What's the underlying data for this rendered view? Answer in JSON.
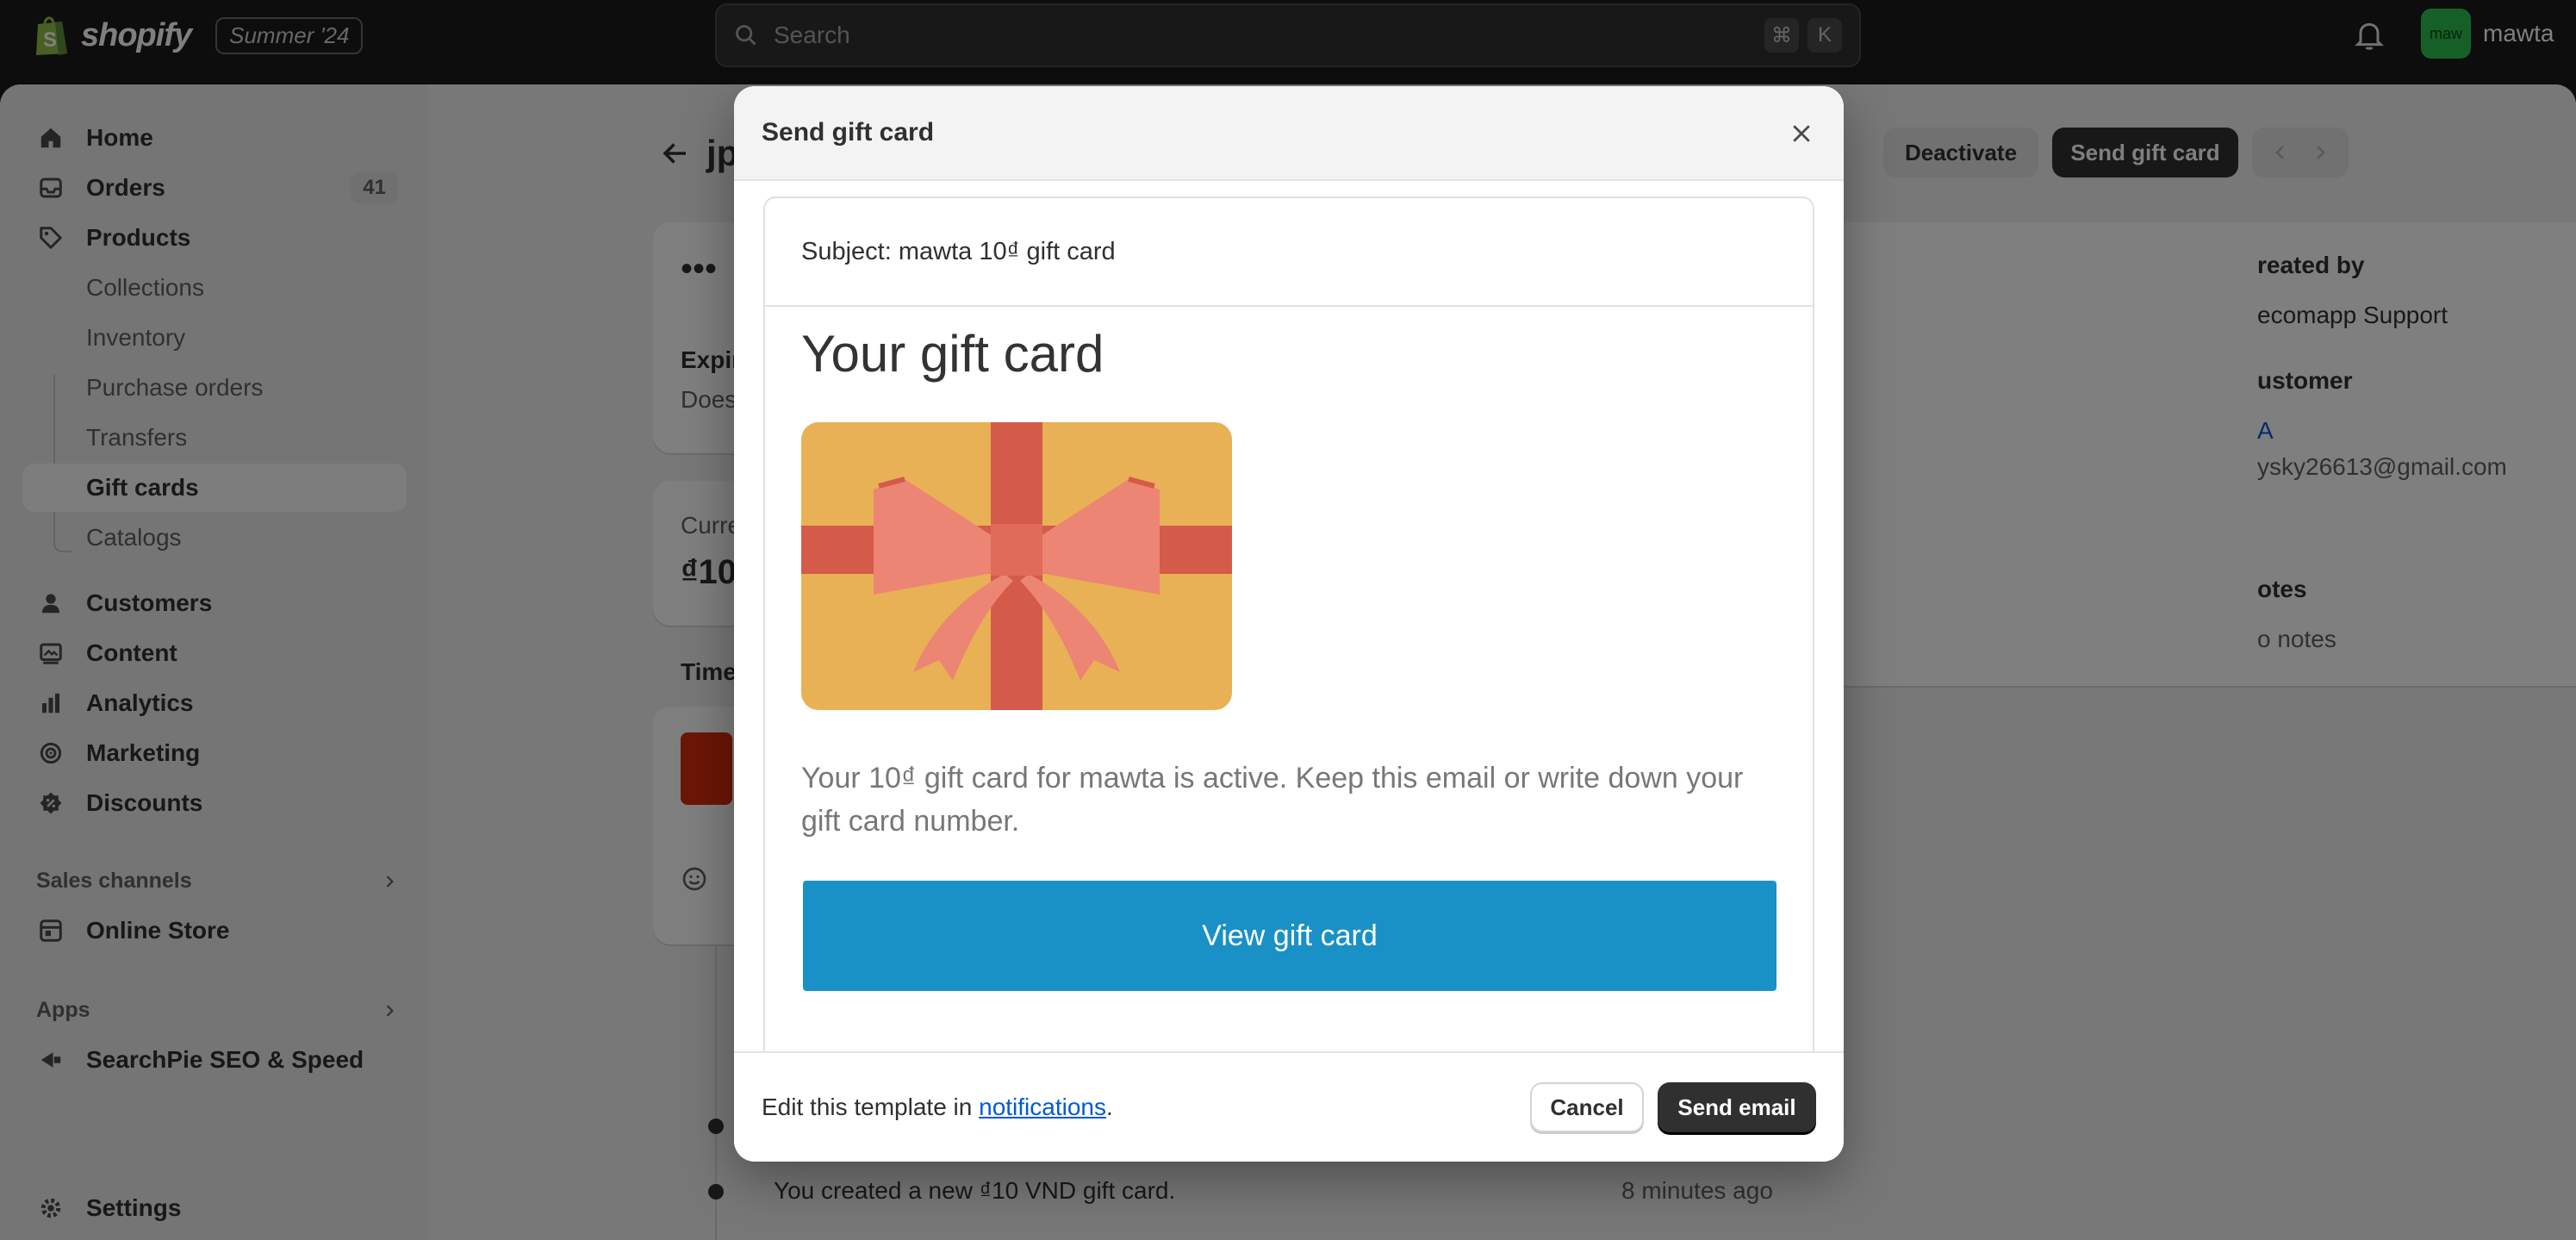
{
  "topbar": {
    "brand": "shopify",
    "edition": "Summer '24",
    "search_placeholder": "Search",
    "shortcut_keys": [
      "⌘",
      "K"
    ],
    "user_initials": "maw",
    "user_name": "mawta"
  },
  "sidebar": {
    "items": [
      {
        "label": "Home",
        "icon": "home-icon"
      },
      {
        "label": "Orders",
        "icon": "inbox-icon",
        "badge": "41"
      },
      {
        "label": "Products",
        "icon": "tag-icon"
      },
      {
        "label": "Collections"
      },
      {
        "label": "Inventory"
      },
      {
        "label": "Purchase orders"
      },
      {
        "label": "Transfers"
      },
      {
        "label": "Gift cards",
        "active": true
      },
      {
        "label": "Catalogs"
      },
      {
        "label": "Customers",
        "icon": "person-icon"
      },
      {
        "label": "Content",
        "icon": "content-icon"
      },
      {
        "label": "Analytics",
        "icon": "analytics-icon"
      },
      {
        "label": "Marketing",
        "icon": "target-icon"
      },
      {
        "label": "Discounts",
        "icon": "discount-icon"
      }
    ],
    "sales_channels_heading": "Sales channels",
    "online_store": "Online Store",
    "apps_heading": "Apps",
    "app_item": "SearchPie SEO & Speed",
    "settings": "Settings"
  },
  "page": {
    "title_partial": "jp",
    "code_masked": "•••",
    "expires_label": "Expir",
    "expires_value": "Does",
    "current_label": "Curre",
    "current_value": "₫10",
    "timeline_label": "Time",
    "deactivate": "Deactivate",
    "send_gift_card": "Send gift card",
    "created_by_label": "reated by",
    "created_by_value": "ecomapp Support",
    "customer_label": "ustomer",
    "customer_name": "A",
    "customer_email": "ysky26613@gmail.com",
    "notes_label": "otes",
    "notes_value": "o notes",
    "timeline_event": "You created a new ₫10 VND gift card.",
    "timeline_time": "8 minutes ago"
  },
  "modal": {
    "title": "Send gift card",
    "subject": "Subject: mawta 10₫ gift card",
    "heading": "Your gift card",
    "message": "Your 10₫ gift card for mawta is active. Keep this email or write down your gift card number.",
    "view_button": "View gift card",
    "footer_prefix": "Edit this template in ",
    "footer_link": "notifications",
    "footer_suffix": ".",
    "cancel": "Cancel",
    "send": "Send email"
  },
  "colors": {
    "topbar_bg": "#1a1a1a",
    "avatar_bg": "#2fbf50",
    "view_button_bg": "#1990c6",
    "link": "#005bd3",
    "gift_card_bg": "#e8b155",
    "ribbon": "#d45a4a",
    "bow": "#ec8573"
  }
}
